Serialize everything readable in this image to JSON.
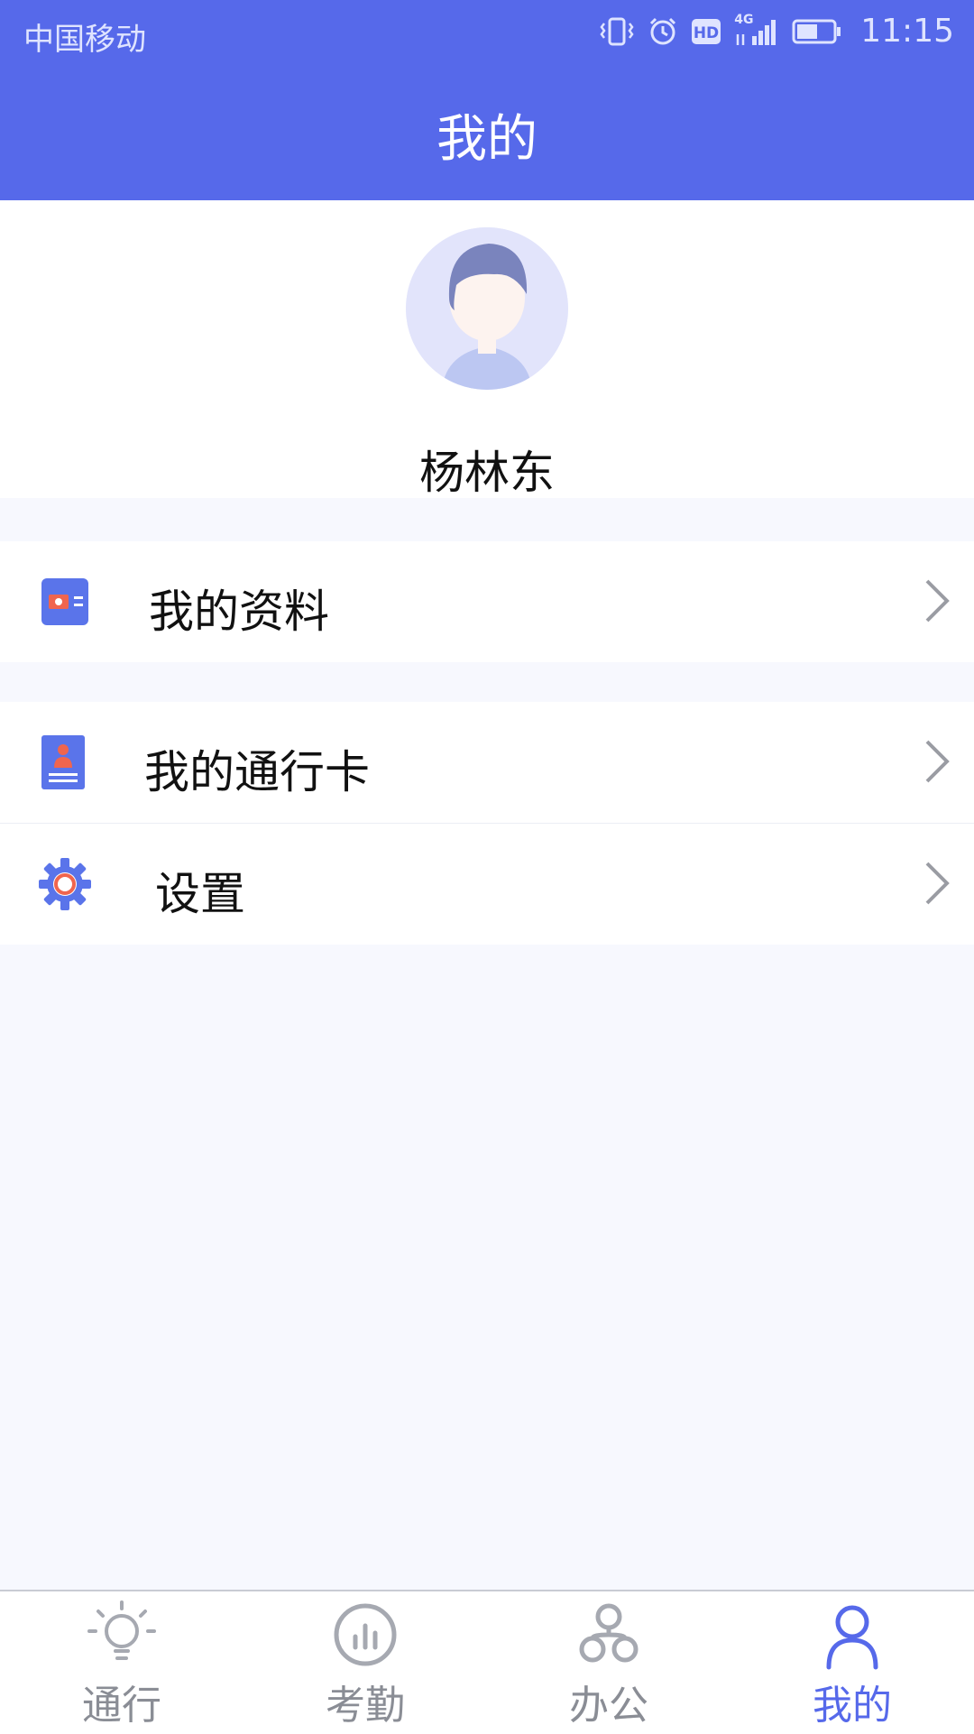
{
  "status_bar": {
    "carrier": "中国移动",
    "network": "4G",
    "time": "11:15"
  },
  "header": {
    "title": "我的"
  },
  "profile": {
    "username": "杨林东"
  },
  "menu": [
    {
      "label": "我的资料",
      "icon": "profile-card-icon"
    },
    {
      "label": "我的通行卡",
      "icon": "pass-card-icon"
    },
    {
      "label": "设置",
      "icon": "gear-icon"
    }
  ],
  "tabs": [
    {
      "label": "通行",
      "icon": "lightbulb-icon",
      "active": false
    },
    {
      "label": "考勤",
      "icon": "chart-circle-icon",
      "active": false
    },
    {
      "label": "办公",
      "icon": "org-chart-icon",
      "active": false
    },
    {
      "label": "我的",
      "icon": "person-icon",
      "active": true
    }
  ],
  "colors": {
    "primary": "#5669EA",
    "inactive": "#8A8D95",
    "background": "#F7F8FE",
    "accent_red": "#F0654E"
  }
}
